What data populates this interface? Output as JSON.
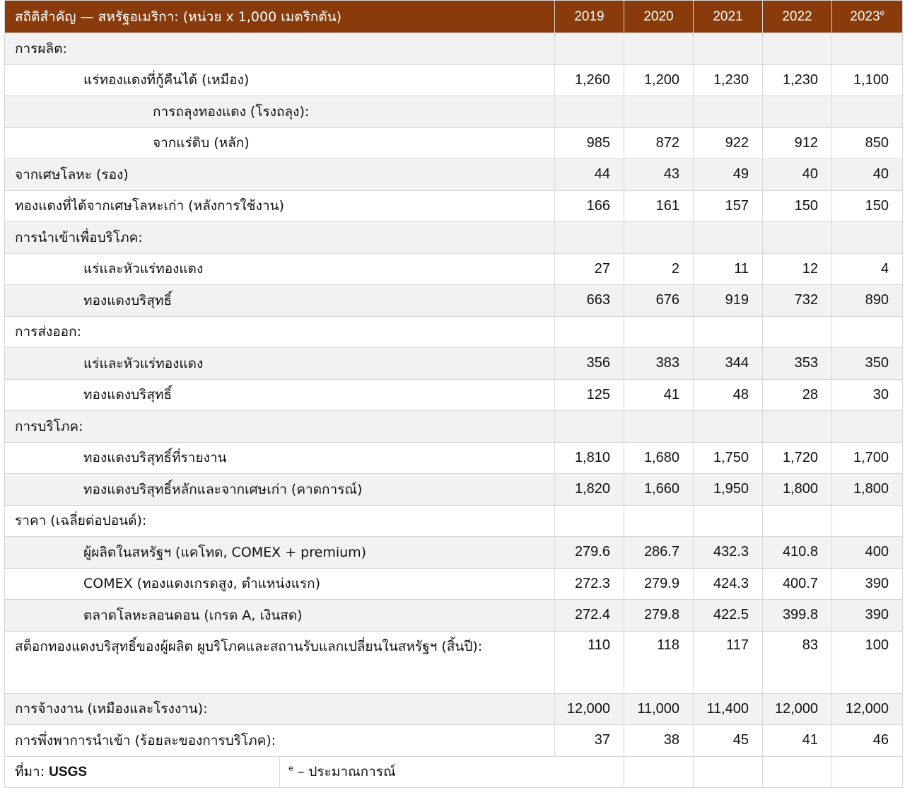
{
  "table": {
    "title": "สถิติสำคัญ — สหรัฐอเมริกา: (หน่วย x 1,000 เมตริกตัน)",
    "years": [
      "2019",
      "2020",
      "2021",
      "2022",
      "2023"
    ],
    "estimate_marker": "e",
    "rows": [
      {
        "label": "การผลิต:",
        "values": [
          "",
          "",
          "",
          "",
          ""
        ]
      },
      {
        "label": "แร่ทองแดงที่กู้คืนได้ (เหมือง)",
        "values": [
          "1,260",
          "1,200",
          "1,230",
          "1,230",
          "1,100"
        ]
      },
      {
        "label": "การถลุงทองแดง (โรงถลุง):",
        "values": [
          "",
          "",
          "",
          "",
          ""
        ]
      },
      {
        "label": "จากแร่ดิบ (หลัก)",
        "values": [
          "985",
          "872",
          "922",
          "912",
          "850"
        ]
      },
      {
        "label": "จากเศษโลหะ (รอง)",
        "values": [
          "44",
          "43",
          "49",
          "40",
          "40"
        ]
      },
      {
        "label": "ทองแดงที่ได้จากเศษโลหะเก่า (หลังการใช้งาน)",
        "values": [
          "166",
          "161",
          "157",
          "150",
          "150"
        ]
      },
      {
        "label": "การนำเข้าเพื่อบริโภค:",
        "values": [
          "",
          "",
          "",
          "",
          ""
        ]
      },
      {
        "label": "แร่และหัวแร่ทองแดง",
        "values": [
          "27",
          "2",
          "11",
          "12",
          "4"
        ]
      },
      {
        "label": "ทองแดงบริสุทธิ์",
        "values": [
          "663",
          "676",
          "919",
          "732",
          "890"
        ]
      },
      {
        "label": "การส่งออก:",
        "values": [
          "",
          "",
          "",
          "",
          ""
        ]
      },
      {
        "label": "แร่และหัวแร่ทองแดง",
        "values": [
          "356",
          "383",
          "344",
          "353",
          "350"
        ]
      },
      {
        "label": "ทองแดงบริสุทธิ์",
        "values": [
          "125",
          "41",
          "48",
          "28",
          "30"
        ]
      },
      {
        "label": "การบริโภค:",
        "values": [
          "",
          "",
          "",
          "",
          ""
        ]
      },
      {
        "label": "ทองแดงบริสุทธิ์ที่รายงาน",
        "values": [
          "1,810",
          "1,680",
          "1,750",
          "1,720",
          "1,700"
        ]
      },
      {
        "label": "ทองแดงบริสุทธิ์หลักและจากเศษเก่า (คาดการณ์)",
        "values": [
          "1,820",
          "1,660",
          "1,950",
          "1,800",
          "1,800"
        ]
      },
      {
        "label": "ราคา (เฉลี่ยต่อปอนด์):",
        "values": [
          "",
          "",
          "",
          "",
          ""
        ]
      },
      {
        "label": "ผู้ผลิตในสหรัฐฯ (แคโทด, COMEX + premium)",
        "values": [
          "279.6",
          "286.7",
          "432.3",
          "410.8",
          "400"
        ]
      },
      {
        "label": "COMEX (ทองแดงเกรดสูง, ตำแหน่งแรก)",
        "values": [
          "272.3",
          "279.9",
          "424.3",
          "400.7",
          "390"
        ]
      },
      {
        "label": "ตลาดโลหะลอนดอน (เกรด A, เงินสด)",
        "values": [
          "272.4",
          "279.8",
          "422.5",
          "399.8",
          "390"
        ]
      },
      {
        "label": "สต็อกทองแดงบริสุทธิ์ของผู้ผลิต ผูบริโภคและสถานรับแลกเปลี่ยนในสหรัฐฯ (สิ้นปี):",
        "values": [
          "110",
          "118",
          "117",
          "83",
          "100"
        ]
      },
      {
        "label": "การจ้างงาน (เหมืองและโรงงาน):",
        "values": [
          "12,000",
          "11,000",
          "11,400",
          "12,000",
          "12,000"
        ]
      },
      {
        "label": "การพึ่งพาการนำเข้า (ร้อยละของการบริโภค):",
        "values": [
          "37",
          "38",
          "45",
          "41",
          "46"
        ]
      }
    ],
    "footer": {
      "source_label": "ที่มา:",
      "source_value": "USGS",
      "note_marker": "e",
      "note_text": "– ประมาณการณ์"
    }
  }
}
